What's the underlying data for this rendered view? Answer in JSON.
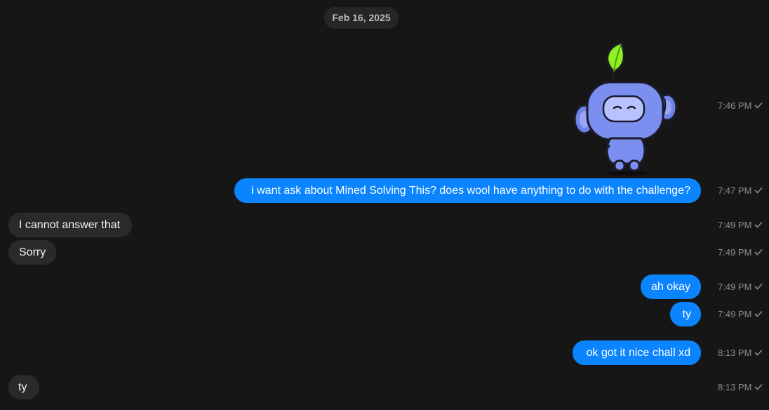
{
  "date_separator": "Feb 16, 2025",
  "messages": [
    {
      "direction": "out",
      "type": "sticker",
      "sticker": "wumpus-waving-leaf",
      "time": "7:46 PM",
      "status": "sent-check"
    },
    {
      "direction": "out",
      "type": "text",
      "text": "i want ask about Mined Solving This? does wool have anything to do with the challenge?",
      "time": "7:47 PM",
      "status": "sent-check"
    },
    {
      "direction": "in",
      "type": "text",
      "text": "I cannot answer that",
      "time": "7:49 PM",
      "status": "sent-check"
    },
    {
      "direction": "in",
      "type": "text",
      "text": "Sorry",
      "time": "7:49 PM",
      "status": "sent-check"
    },
    {
      "direction": "out",
      "type": "text",
      "text": "ah okay",
      "time": "7:49 PM",
      "status": "sent-check"
    },
    {
      "direction": "out",
      "type": "text",
      "text": "ty",
      "time": "7:49 PM",
      "status": "sent-check"
    },
    {
      "direction": "out",
      "type": "text",
      "text": "ok got it nice chall xd",
      "time": "8:13 PM",
      "status": "sent-check"
    },
    {
      "direction": "in",
      "type": "text",
      "text": "ty",
      "time": "8:13 PM",
      "status": "sent-check"
    }
  ],
  "colors": {
    "background": "#161616",
    "outgoing_bubble": "#0a84ff",
    "incoming_bubble": "#2a2a2a",
    "timestamp": "#8d8d8d",
    "sticker_body": "#7b8ff0",
    "sticker_leaf": "#8ef020"
  }
}
